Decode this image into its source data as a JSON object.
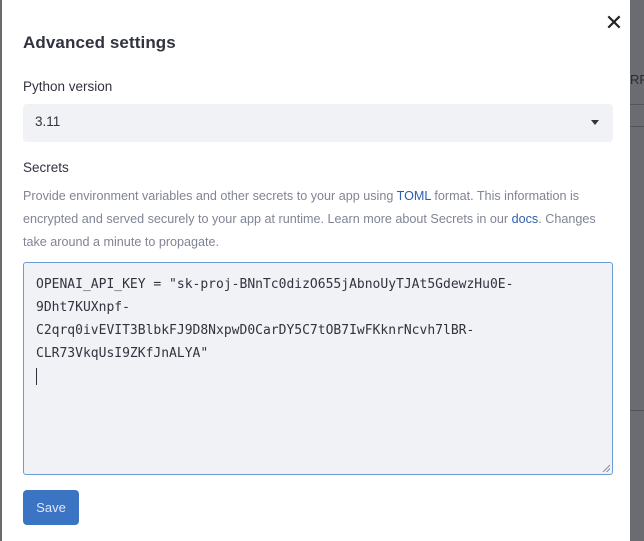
{
  "background": {
    "right_edge_text": "RR"
  },
  "modal": {
    "title": "Advanced settings",
    "close_glyph": "✕"
  },
  "python": {
    "label": "Python version",
    "selected": "3.11"
  },
  "secrets": {
    "label": "Secrets",
    "description_prefix": "Provide environment variables and other secrets to your app using ",
    "toml_link": "TOML",
    "description_middle": " format. This information is encrypted and served securely to your app at runtime. Learn more about Secrets in our ",
    "docs_link": "docs",
    "description_suffix": ". Changes take around a minute to propagate.",
    "value_lines": [
      "OPENAI_API_KEY = \"sk-proj-BNnTc0dizO655jAbnoUyTJAt5GdewzHu0E-",
      "9Dht7KUXnpf-",
      "C2qrq0ivEVIT3BlbkFJ9D8NxpwD0CarDY5C7tOB7IwFKknrNcvh7lBR-",
      "CLR73VkqUsI9ZKfJnALYA\""
    ]
  },
  "actions": {
    "save_label": "Save"
  },
  "colors": {
    "primary": "#3c74c4",
    "link": "#2d5fad",
    "focus_border": "#6a9dd7",
    "input_bg": "#f0f2f6"
  }
}
